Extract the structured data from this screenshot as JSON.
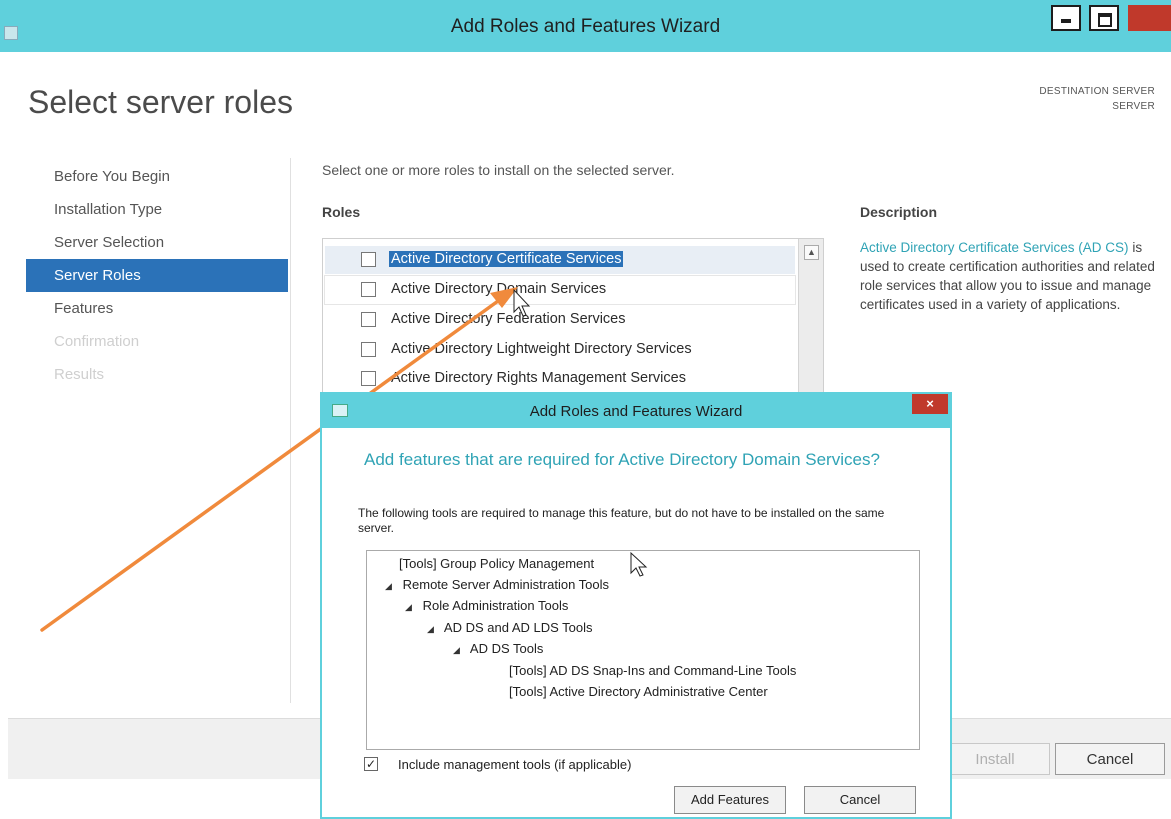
{
  "window": {
    "title": "Add Roles and Features Wizard",
    "page_title": "Select server roles",
    "destination_label": "DESTINATION SERVER",
    "destination_value": "SERVER"
  },
  "nav": {
    "items": [
      {
        "label": "Before You Begin",
        "state": "normal"
      },
      {
        "label": "Installation Type",
        "state": "normal"
      },
      {
        "label": "Server Selection",
        "state": "normal"
      },
      {
        "label": "Server Roles",
        "state": "active"
      },
      {
        "label": "Features",
        "state": "normal"
      },
      {
        "label": "Confirmation",
        "state": "disabled"
      },
      {
        "label": "Results",
        "state": "disabled"
      }
    ]
  },
  "content": {
    "instruction": "Select one or more roles to install on the selected server.",
    "roles_heading": "Roles",
    "description_heading": "Description",
    "description_link": "Active Directory Certificate Services (AD CS)",
    "description_rest": " is used to create certification authorities and related role services that allow you to issue and manage certificates used in a variety of applications.",
    "roles": [
      {
        "label": "Active Directory Certificate Services",
        "checked": false
      },
      {
        "label": "Active Directory Domain Services",
        "checked": false
      },
      {
        "label": "Active Directory Federation Services",
        "checked": false
      },
      {
        "label": "Active Directory Lightweight Directory Services",
        "checked": false
      },
      {
        "label": "Active Directory Rights Management Services",
        "checked": false
      }
    ]
  },
  "footer": {
    "install_label": "Install",
    "cancel_label": "Cancel"
  },
  "dialog": {
    "title": "Add Roles and Features Wizard",
    "close_glyph": "×",
    "heading": "Add features that are required for Active Directory Domain Services?",
    "subtext": "The following tools are required to manage this feature, but do not have to be installed on the same server.",
    "tree": [
      {
        "label": "[Tools] Group Policy Management",
        "level": 0,
        "expander": false
      },
      {
        "label": "Remote Server Administration Tools",
        "level": 0,
        "expander": true
      },
      {
        "label": "Role Administration Tools",
        "level": 1,
        "expander": true
      },
      {
        "label": "AD DS and AD LDS Tools",
        "level": 2,
        "expander": true
      },
      {
        "label": "AD DS Tools",
        "level": 3,
        "expander": true
      },
      {
        "label": "[Tools] AD DS Snap-Ins and Command-Line Tools",
        "level": 4,
        "expander": false
      },
      {
        "label": "[Tools] Active Directory Administrative Center",
        "level": 4,
        "expander": false
      }
    ],
    "expander_glyph": "◢",
    "include_label": "Include management tools (if applicable)",
    "include_checked_glyph": "✓",
    "add_features_label": "Add Features",
    "cancel_label": "Cancel"
  },
  "colors": {
    "titlebar": "#5fd0dc",
    "selection": "#2b72b8",
    "accent_text": "#2fa3b5",
    "arrow": "#f08a3c"
  }
}
